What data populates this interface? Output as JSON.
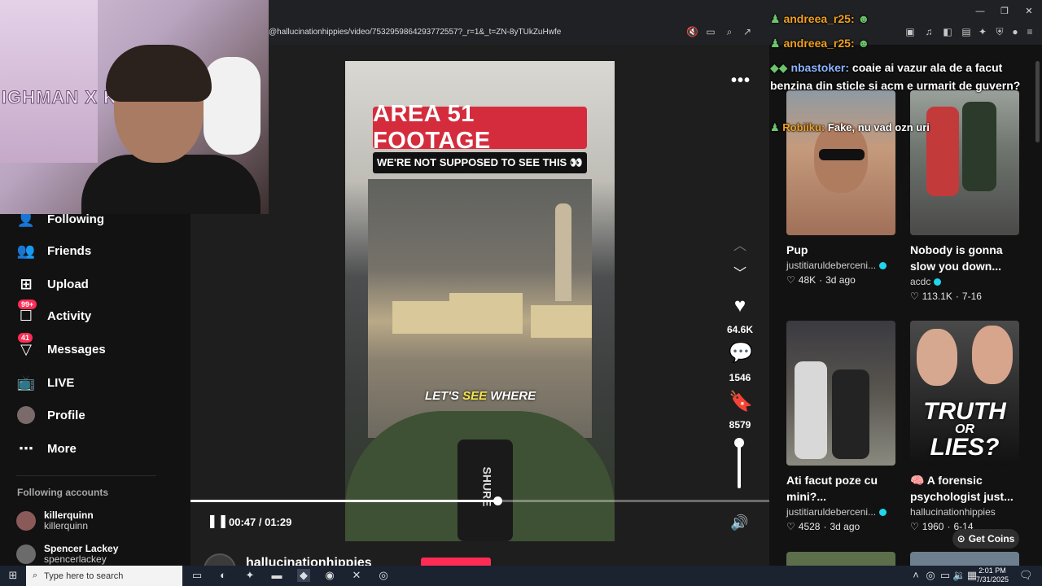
{
  "browser": {
    "url": "@hallucinationhippies/video/7532959864293772557?_r=1&_t=ZN-8yTUkZuHwfe"
  },
  "webcam": {
    "poster_text": "IGHMAN X KICK"
  },
  "sidebar": {
    "items": [
      {
        "label": "Following",
        "icon": "following-icon",
        "badge": ""
      },
      {
        "label": "Friends",
        "icon": "friends-icon",
        "badge": ""
      },
      {
        "label": "Upload",
        "icon": "upload-icon",
        "badge": ""
      },
      {
        "label": "Activity",
        "icon": "activity-icon",
        "badge": "99+"
      },
      {
        "label": "Messages",
        "icon": "messages-icon",
        "badge": "41"
      },
      {
        "label": "LIVE",
        "icon": "live-icon",
        "badge": ""
      },
      {
        "label": "Profile",
        "icon": "profile-avatar",
        "badge": ""
      },
      {
        "label": "More",
        "icon": "more-icon",
        "badge": ""
      }
    ],
    "following_title": "Following accounts",
    "following": [
      {
        "name": "killerquinn",
        "handle": "killerquinn"
      },
      {
        "name": "Spencer Lackey",
        "handle": "spencerlackey"
      }
    ]
  },
  "video": {
    "title_banner": "AREA 51 FOOTAGE",
    "sub_banner": "WE'RE NOT SUPPOSED TO SEE THIS 👀",
    "caption_pre": "LET'S ",
    "caption_hl": "SEE",
    "caption_post": " WHERE",
    "mic_text": "SHURE",
    "likes": "64.6K",
    "comments": "1546",
    "saves": "8579",
    "time": "00:47 / 01:29",
    "progress": 0.53,
    "volume": 0.9,
    "author": "hallucinationhippies"
  },
  "recommended": [
    {
      "title": "Pup",
      "author": "justitiaruldeberceni...",
      "verified": true,
      "likes": "48K",
      "age": "3d ago"
    },
    {
      "title": "Nobody is gonna slow you down...",
      "author": "acdc",
      "verified": true,
      "likes": "113.1K",
      "age": "7-16"
    },
    {
      "title": "Ati facut poze cu mini?...",
      "author": "justitiaruldeberceni...",
      "verified": true,
      "likes": "4528",
      "age": "3d ago"
    },
    {
      "title": "🧠 A forensic psychologist just...",
      "author": "hallucinationhippies",
      "verified": false,
      "likes": "1960",
      "age": "6-14"
    }
  ],
  "thumb_texts": {
    "truth": "TRUTH",
    "or": "OR",
    "lies": "LIES?"
  },
  "get_coins": "Get Coins",
  "chat": [
    {
      "user": "andreea_r25:",
      "text": "",
      "user_color": "orange"
    },
    {
      "user": "andreea_r25:",
      "text": "",
      "user_color": "orange"
    },
    {
      "user": "nbastoker:",
      "text": "coaie ai vazur ala de a facut benzina din sticle si acm e urmarit de guvern?",
      "user_color": "blue"
    },
    {
      "user": "Robiiku:",
      "text": "Fake, nu vad ozn uri",
      "user_color": "orange"
    }
  ],
  "taskbar": {
    "search_placeholder": "Type here to search",
    "time": "2:01 PM",
    "date": "7/31/2025"
  },
  "colors": {
    "accent": "#fe2c55",
    "banner_red": "#d52c3d",
    "caption_highlight": "#f4e44a",
    "verified": "#20d5ec"
  }
}
